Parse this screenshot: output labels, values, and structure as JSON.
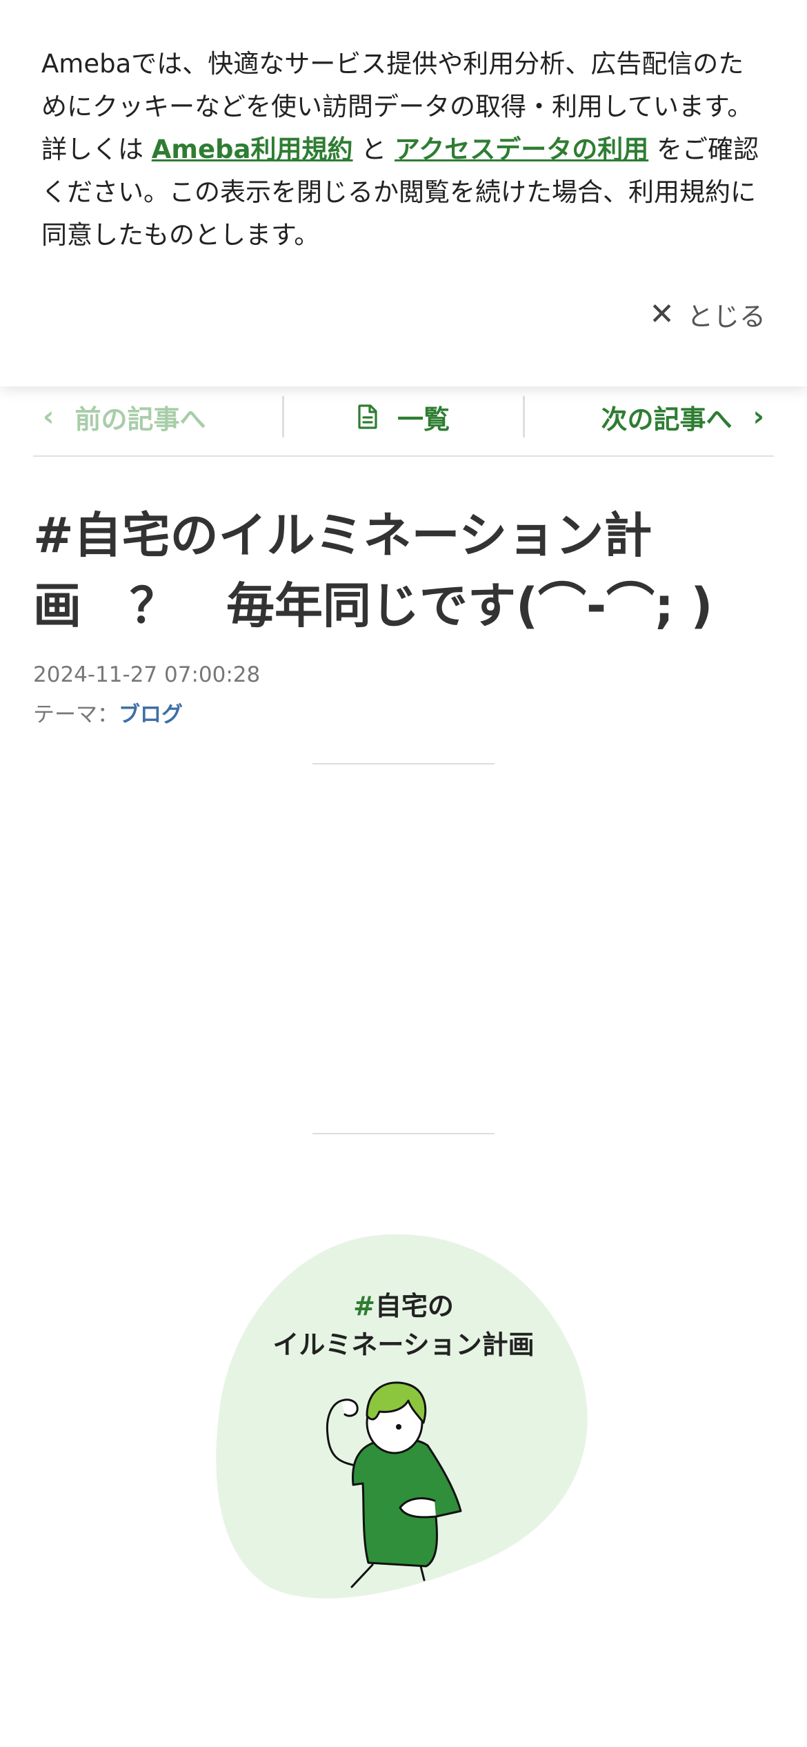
{
  "cookie_banner": {
    "text_1": "Amebaでは、快適なサービス提供や利用分析、広告配信のためにクッキーなどを使い訪問データの取得・利用しています。詳しくは",
    "link_terms": "Ameba利用規約",
    "text_and": "と",
    "link_access": "アクセスデータの利用",
    "text_2": "をご確認ください。この表示を閉じるか閲覧を続けた場合、利用規約に同意したものとします。",
    "close_label": "とじる",
    "close_icon": "✕"
  },
  "nav": {
    "prev_label": "前の記事へ",
    "list_label": "一覧",
    "next_label": "次の記事へ",
    "prev_icon": "‹",
    "next_icon": "›"
  },
  "article": {
    "title": "#自宅のイルミネーション計画　？　毎年同じです(⌒-⌒; )",
    "date": "2024-11-27 07:00:28",
    "theme_label": "テーマ：",
    "theme_value": "ブログ"
  },
  "hero": {
    "hash": "#",
    "line_1": "自宅の",
    "line_2": "イルミネーション計画"
  },
  "colors": {
    "accent_green": "#2e7d32",
    "link_blue": "#3d6fa6",
    "blob_green": "#e6f4e4"
  }
}
